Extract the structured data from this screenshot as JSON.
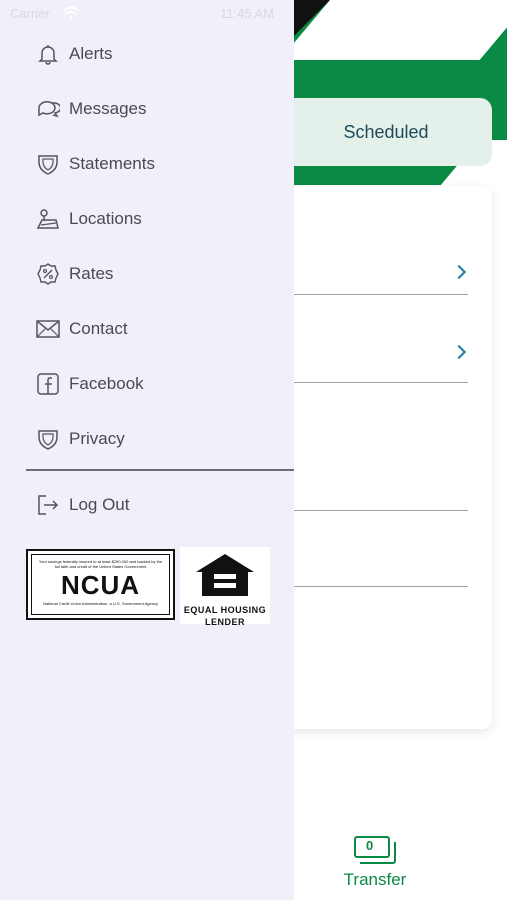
{
  "status_bar": {
    "carrier": "Carrier",
    "time": "11:45 AM"
  },
  "menu": {
    "items": [
      {
        "label": "Alerts",
        "icon": "bell-icon"
      },
      {
        "label": "Messages",
        "icon": "chat-bubbles-icon"
      },
      {
        "label": "Statements",
        "icon": "shield-icon"
      },
      {
        "label": "Locations",
        "icon": "map-pin-icon"
      },
      {
        "label": "Rates",
        "icon": "percent-badge-icon"
      },
      {
        "label": "Contact",
        "icon": "envelope-icon"
      },
      {
        "label": "Facebook",
        "icon": "facebook-icon"
      },
      {
        "label": "Privacy",
        "icon": "shield-icon"
      }
    ],
    "logout": {
      "label": "Log Out",
      "icon": "logout-icon"
    }
  },
  "badges": {
    "ncua": {
      "top_text": "Your savings federally insured to at least $250,000 and backed by the full faith and credit of the United States Government",
      "name": "NCUA",
      "bottom_text": "National Credit Union Administration, a U.S. Government Agency"
    },
    "equal_housing": {
      "line1": "EQUAL HOUSING",
      "line2": "LENDER"
    }
  },
  "background": {
    "tab_label": "Scheduled",
    "tabbar_transfer_label": "Transfer",
    "transfer_icon_text": "0"
  },
  "colors": {
    "brand_green": "#0b8a45",
    "menu_background": "#f1eff9",
    "chevron_blue": "#1d79a8",
    "tab_background": "#e4f0ea"
  }
}
